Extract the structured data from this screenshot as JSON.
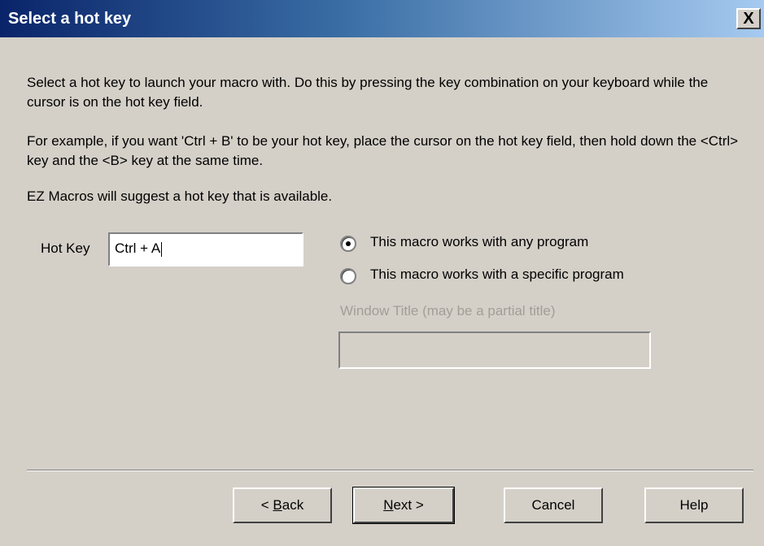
{
  "window": {
    "title": "Select a hot key",
    "close_glyph": "X"
  },
  "instructions": {
    "p1": "Select a hot key to launch your macro with.  Do this by pressing the key combination on your keyboard while the cursor is on the hot key field.",
    "p2": "For example, if you want 'Ctrl + B' to be your hot key, place the cursor on the hot key field, then hold down the <Ctrl> key and the <B> key at the same time.",
    "p3": "EZ Macros will suggest a hot key that is available."
  },
  "hotkey": {
    "label": "Hot Key",
    "value": "Ctrl + A"
  },
  "options": {
    "any_program": "This macro works with any program",
    "specific_program": "This macro works with a specific program",
    "selected": "any_program"
  },
  "window_title_field": {
    "label": "Window Title (may be a partial title)",
    "value": ""
  },
  "buttons": {
    "back_prefix": "< ",
    "back_mnemonic": "B",
    "back_rest": "ack",
    "next_mnemonic": "N",
    "next_rest": "ext >",
    "cancel": "Cancel",
    "help": "Help"
  }
}
